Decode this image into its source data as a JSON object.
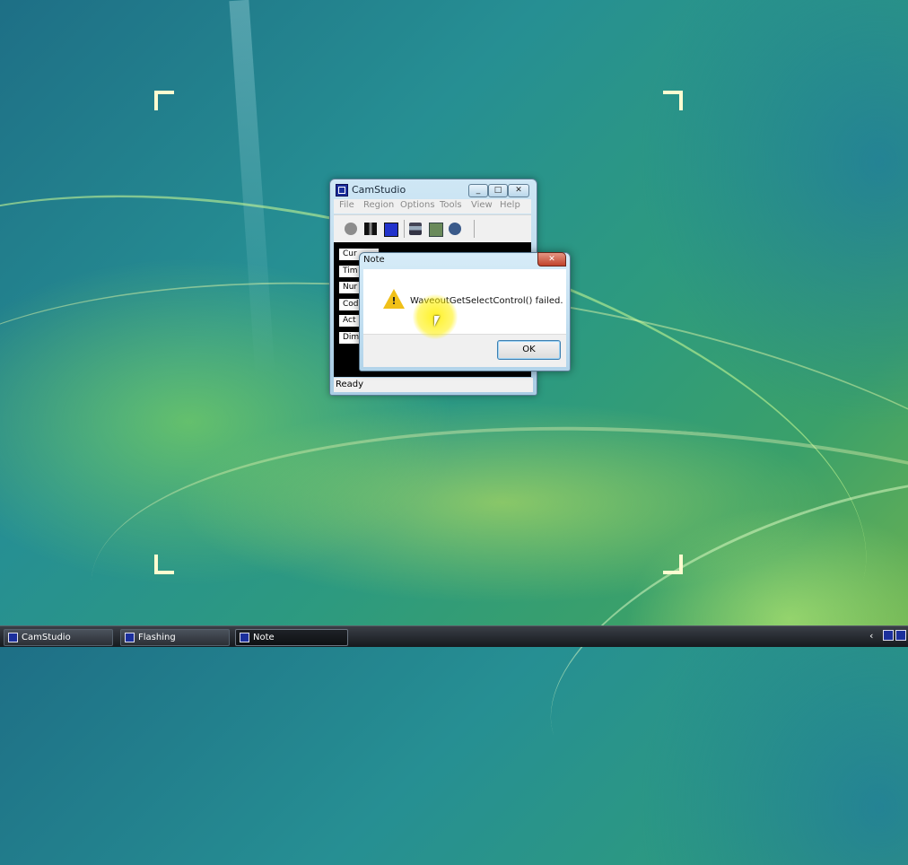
{
  "camstudio_window": {
    "title": "CamStudio",
    "menu": [
      "File",
      "Region",
      "Options",
      "Tools",
      "View",
      "Help"
    ],
    "labels": [
      "Cur",
      "Tim",
      "Nur",
      "Cod",
      "Act",
      "Dim"
    ],
    "status": "Ready"
  },
  "dialog": {
    "title": "Note",
    "message": "WaveoutGetSelectControl() failed.",
    "ok_label": "OK",
    "icon": "warning-icon"
  },
  "taskbar": {
    "items": [
      {
        "label": "CamStudio",
        "active": false
      },
      {
        "label": "Flashing",
        "active": false
      },
      {
        "label": "Note",
        "active": true
      }
    ],
    "tray_chevron": "‹"
  },
  "colors": {
    "dialog_close": "#c0432b",
    "warning": "#f0c018",
    "cursor_highlight": "#fff000"
  }
}
